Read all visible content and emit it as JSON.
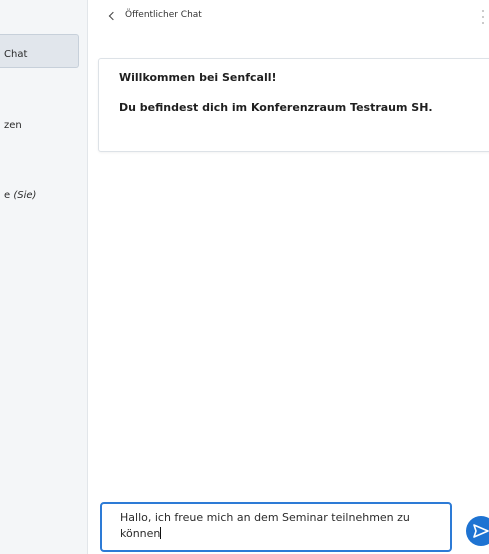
{
  "sidebar": {
    "items": [
      {
        "label": "Chat"
      },
      {
        "label": "zen"
      },
      {
        "label_prefix": "e ",
        "label_suffix": "(Sie)"
      }
    ]
  },
  "header": {
    "back_label": "Öffentlicher Chat",
    "back_icon": "chevron-left-icon",
    "menu_icon": "kebab-menu-icon"
  },
  "welcome": {
    "line1": "Willkommen bei Senfcall!",
    "line2": "Du befindest dich im Konferenzraum Testraum SH."
  },
  "composer": {
    "value": "Hallo, ich freue mich an dem Seminar teilnehmen zu können"
  },
  "send": {
    "icon": "send-icon",
    "color": "#1e73d2"
  },
  "colors": {
    "accent": "#2d7bd6",
    "sidebar_bg": "#f4f6f8"
  }
}
